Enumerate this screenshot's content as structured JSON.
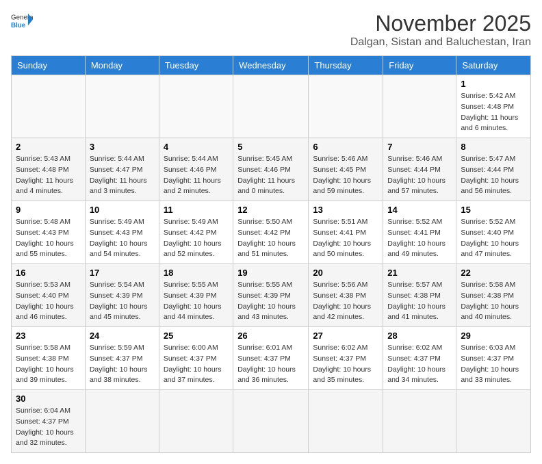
{
  "header": {
    "logo_general": "General",
    "logo_blue": "Blue",
    "month": "November 2025",
    "location": "Dalgan, Sistan and Baluchestan, Iran"
  },
  "weekdays": [
    "Sunday",
    "Monday",
    "Tuesday",
    "Wednesday",
    "Thursday",
    "Friday",
    "Saturday"
  ],
  "weeks": [
    [
      {
        "day": "",
        "info": ""
      },
      {
        "day": "",
        "info": ""
      },
      {
        "day": "",
        "info": ""
      },
      {
        "day": "",
        "info": ""
      },
      {
        "day": "",
        "info": ""
      },
      {
        "day": "",
        "info": ""
      },
      {
        "day": "1",
        "info": "Sunrise: 5:42 AM\nSunset: 4:48 PM\nDaylight: 11 hours and 6 minutes."
      }
    ],
    [
      {
        "day": "2",
        "info": "Sunrise: 5:43 AM\nSunset: 4:48 PM\nDaylight: 11 hours and 4 minutes."
      },
      {
        "day": "3",
        "info": "Sunrise: 5:44 AM\nSunset: 4:47 PM\nDaylight: 11 hours and 3 minutes."
      },
      {
        "day": "4",
        "info": "Sunrise: 5:44 AM\nSunset: 4:46 PM\nDaylight: 11 hours and 2 minutes."
      },
      {
        "day": "5",
        "info": "Sunrise: 5:45 AM\nSunset: 4:46 PM\nDaylight: 11 hours and 0 minutes."
      },
      {
        "day": "6",
        "info": "Sunrise: 5:46 AM\nSunset: 4:45 PM\nDaylight: 10 hours and 59 minutes."
      },
      {
        "day": "7",
        "info": "Sunrise: 5:46 AM\nSunset: 4:44 PM\nDaylight: 10 hours and 57 minutes."
      },
      {
        "day": "8",
        "info": "Sunrise: 5:47 AM\nSunset: 4:44 PM\nDaylight: 10 hours and 56 minutes."
      }
    ],
    [
      {
        "day": "9",
        "info": "Sunrise: 5:48 AM\nSunset: 4:43 PM\nDaylight: 10 hours and 55 minutes."
      },
      {
        "day": "10",
        "info": "Sunrise: 5:49 AM\nSunset: 4:43 PM\nDaylight: 10 hours and 54 minutes."
      },
      {
        "day": "11",
        "info": "Sunrise: 5:49 AM\nSunset: 4:42 PM\nDaylight: 10 hours and 52 minutes."
      },
      {
        "day": "12",
        "info": "Sunrise: 5:50 AM\nSunset: 4:42 PM\nDaylight: 10 hours and 51 minutes."
      },
      {
        "day": "13",
        "info": "Sunrise: 5:51 AM\nSunset: 4:41 PM\nDaylight: 10 hours and 50 minutes."
      },
      {
        "day": "14",
        "info": "Sunrise: 5:52 AM\nSunset: 4:41 PM\nDaylight: 10 hours and 49 minutes."
      },
      {
        "day": "15",
        "info": "Sunrise: 5:52 AM\nSunset: 4:40 PM\nDaylight: 10 hours and 47 minutes."
      }
    ],
    [
      {
        "day": "16",
        "info": "Sunrise: 5:53 AM\nSunset: 4:40 PM\nDaylight: 10 hours and 46 minutes."
      },
      {
        "day": "17",
        "info": "Sunrise: 5:54 AM\nSunset: 4:39 PM\nDaylight: 10 hours and 45 minutes."
      },
      {
        "day": "18",
        "info": "Sunrise: 5:55 AM\nSunset: 4:39 PM\nDaylight: 10 hours and 44 minutes."
      },
      {
        "day": "19",
        "info": "Sunrise: 5:55 AM\nSunset: 4:39 PM\nDaylight: 10 hours and 43 minutes."
      },
      {
        "day": "20",
        "info": "Sunrise: 5:56 AM\nSunset: 4:38 PM\nDaylight: 10 hours and 42 minutes."
      },
      {
        "day": "21",
        "info": "Sunrise: 5:57 AM\nSunset: 4:38 PM\nDaylight: 10 hours and 41 minutes."
      },
      {
        "day": "22",
        "info": "Sunrise: 5:58 AM\nSunset: 4:38 PM\nDaylight: 10 hours and 40 minutes."
      }
    ],
    [
      {
        "day": "23",
        "info": "Sunrise: 5:58 AM\nSunset: 4:38 PM\nDaylight: 10 hours and 39 minutes."
      },
      {
        "day": "24",
        "info": "Sunrise: 5:59 AM\nSunset: 4:37 PM\nDaylight: 10 hours and 38 minutes."
      },
      {
        "day": "25",
        "info": "Sunrise: 6:00 AM\nSunset: 4:37 PM\nDaylight: 10 hours and 37 minutes."
      },
      {
        "day": "26",
        "info": "Sunrise: 6:01 AM\nSunset: 4:37 PM\nDaylight: 10 hours and 36 minutes."
      },
      {
        "day": "27",
        "info": "Sunrise: 6:02 AM\nSunset: 4:37 PM\nDaylight: 10 hours and 35 minutes."
      },
      {
        "day": "28",
        "info": "Sunrise: 6:02 AM\nSunset: 4:37 PM\nDaylight: 10 hours and 34 minutes."
      },
      {
        "day": "29",
        "info": "Sunrise: 6:03 AM\nSunset: 4:37 PM\nDaylight: 10 hours and 33 minutes."
      }
    ],
    [
      {
        "day": "30",
        "info": "Sunrise: 6:04 AM\nSunset: 4:37 PM\nDaylight: 10 hours and 32 minutes."
      },
      {
        "day": "",
        "info": ""
      },
      {
        "day": "",
        "info": ""
      },
      {
        "day": "",
        "info": ""
      },
      {
        "day": "",
        "info": ""
      },
      {
        "day": "",
        "info": ""
      },
      {
        "day": "",
        "info": ""
      }
    ]
  ]
}
